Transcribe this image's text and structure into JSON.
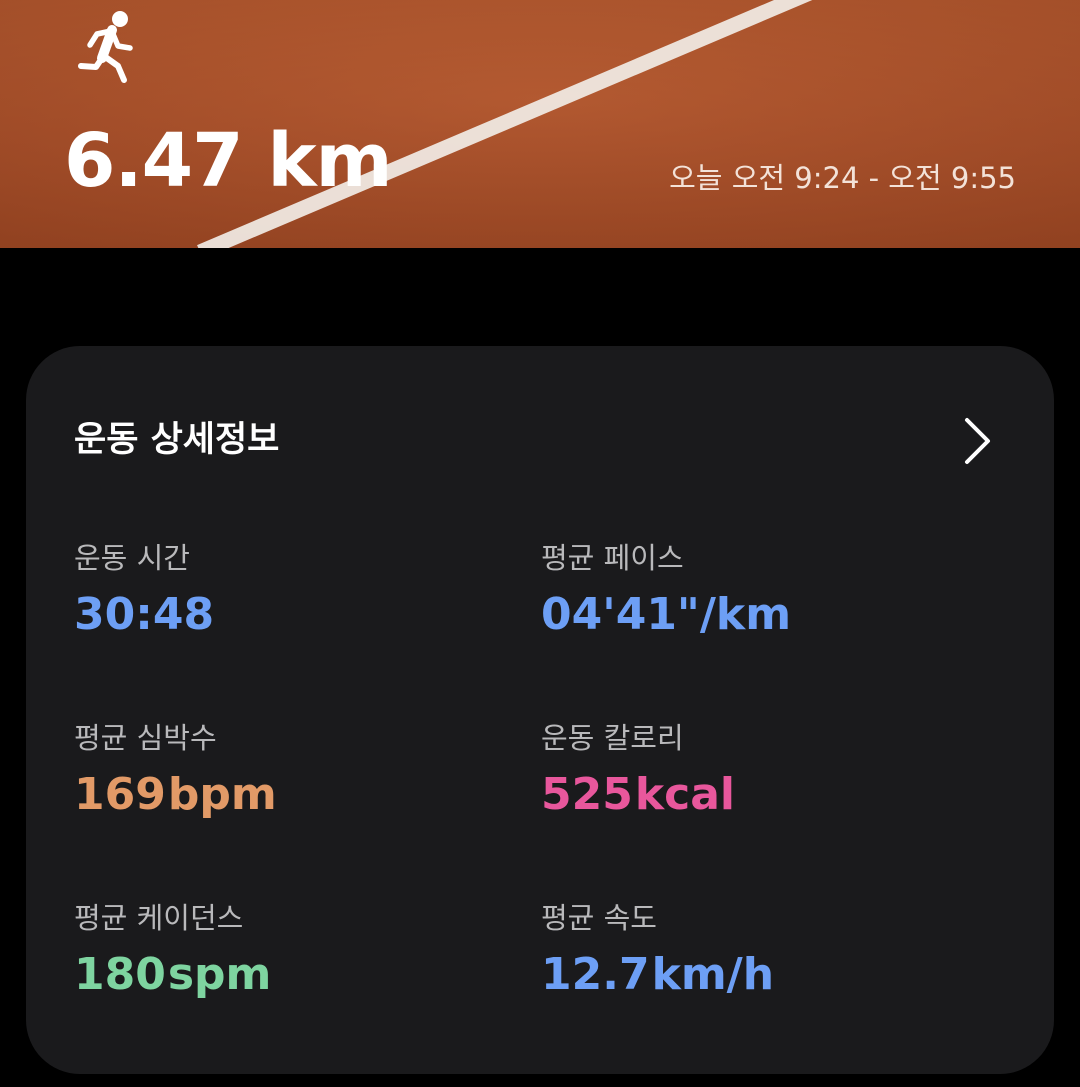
{
  "header": {
    "activity_icon": "running-person-icon",
    "distance": "6.47 km",
    "time_range": "오늘 오전 9:24 - 오전 9:55",
    "background_color": "#a84f2a"
  },
  "details": {
    "title": "운동 상세정보",
    "chevron_icon": "chevron-right-icon",
    "stats": {
      "duration": {
        "label": "운동 시간",
        "value": "30:48",
        "unit": "",
        "color": "#6d9ff5"
      },
      "pace": {
        "label": "평균 페이스",
        "value": "04'41\"/km",
        "unit": "",
        "color": "#6d9ff5"
      },
      "heart_rate": {
        "label": "평균 심박수",
        "value": "169",
        "unit": "bpm",
        "color": "#e29a67"
      },
      "calories": {
        "label": "운동 칼로리",
        "value": "525",
        "unit": "kcal",
        "color": "#e8579c"
      },
      "cadence": {
        "label": "평균 케이던스",
        "value": "180",
        "unit": "spm",
        "color": "#7ed4a0"
      },
      "speed": {
        "label": "평균 속도",
        "value": "12.7",
        "unit": "km/h",
        "color": "#6d9ff5"
      }
    }
  }
}
